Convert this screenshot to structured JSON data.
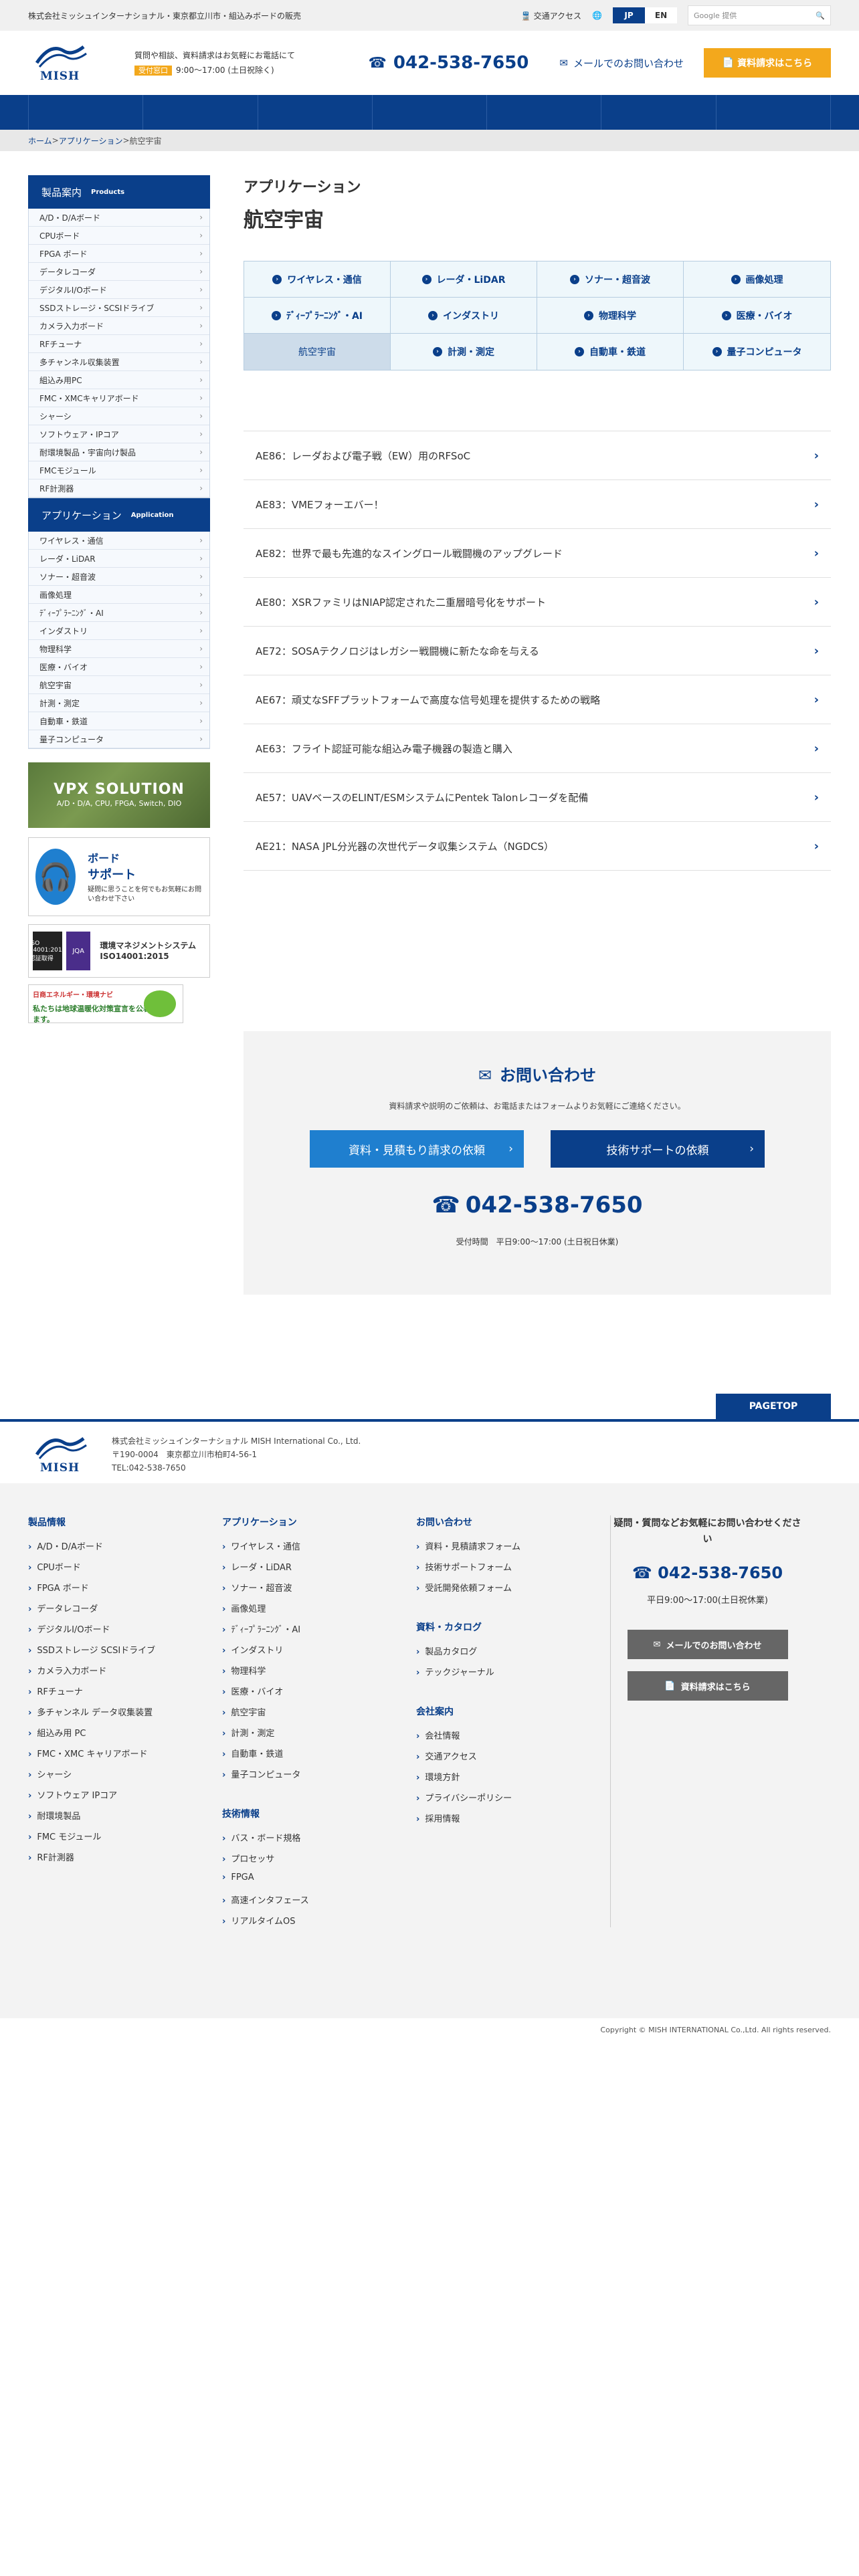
{
  "topbar": {
    "company": "株式会社ミッシュインターナショナル・東京都立川市・組込みボードの販売",
    "access": "交通アクセス",
    "lang_jp": "JP",
    "lang_en": "EN",
    "search_placeholder": "Google 提供",
    "colors": {
      "brand": "#0a3f8a",
      "accent": "#f3a81c"
    }
  },
  "header": {
    "logo": "MISH",
    "info": "質問や相談、資料請求はお気軽にお電話にて",
    "badge": "受付窓口",
    "hours": "9:00〜17:00 (土日祝除く)",
    "phone": "042-538-7650",
    "mail": "メールでのお問い合わせ",
    "request": "資料請求はこちら"
  },
  "breadcrumb": {
    "home": "ホーム",
    "sep1": " > ",
    "app": "アプリケーション",
    "sep2": " > ",
    "current": "航空宇宙"
  },
  "sidebar": {
    "products_title": "製品案内",
    "products_sub": "Products",
    "products": [
      "A/D・D/Aボード",
      "CPUボード",
      "FPGA ボード",
      "データレコーダ",
      "デジタルI/Oボード",
      "SSDストレージ・SCSIドライブ",
      "カメラ入力ボード",
      "RFチューナ",
      "多チャンネル収集装置",
      "組込み用PC",
      "FMC・XMCキャリアボード",
      "シャーシ",
      "ソフトウェア・IPコア",
      "耐環境製品・宇宙向け製品",
      "FMCモジュール",
      "RF計測器"
    ],
    "apps_title": "アプリケーション",
    "apps_sub": "Application",
    "apps": [
      "ワイヤレス・通信",
      "レーダ・LiDAR",
      "ソナー・超音波",
      "画像処理",
      "ﾃﾞｨｰﾌﾟﾗｰﾆﾝｸﾞ・AI",
      "インダストリ",
      "物理科学",
      "医療・バイオ",
      "航空宇宙",
      "計測・測定",
      "自動車・鉄道",
      "量子コンピュータ"
    ]
  },
  "banners": {
    "vpx_title": "VPX SOLUTION",
    "vpx_sub": "A/D・D/A, CPU, FPGA, Switch, DIO",
    "support_a": "ボード",
    "support_b": "サポート",
    "support_c": "疑問に思うことを何でもお気軽にお問い合わせ下さい",
    "iso_label": "環境マネジメントシステム ISO14001:2015",
    "iso_badge": "JQA",
    "iso_note": "ISO 14001:2015 認証取得",
    "eco_l1": "日商エネルギー・環境ナビ",
    "eco_l2": "私たちは地球温暖化対策宣言を公表しています。"
  },
  "content": {
    "caption": "アプリケーション",
    "title": "航空宇宙",
    "categories": [
      "ワイヤレス・通信",
      "レーダ・LiDAR",
      "ソナー・超音波",
      "画像処理",
      "ﾃﾞｨｰﾌﾟﾗｰﾆﾝｸﾞ・AI",
      "インダストリ",
      "物理科学",
      "医療・バイオ",
      "航空宇宙",
      "計測・測定",
      "自動車・鉄道",
      "量子コンピュータ"
    ],
    "articles": [
      "AE86：レーダおよび電子戦（EW）用のRFSoC",
      "AE83：VMEフォーエバー！",
      "AE82：世界で最も先進的なスイングロール戦闘機のアップグレード",
      "AE80：XSRファミリはNIAP認定された二重層暗号化をサポート",
      "AE72：SOSAテクノロジはレガシー戦闘機に新たな命を与える",
      "AE67：頑丈なSFFプラットフォームで高度な信号処理を提供するための戦略",
      "AE63：フライト認証可能な組込み電子機器の製造と購入",
      "AE57：UAVベースのELINT/ESMシステムにPentek Talonレコーダを配備",
      "AE21：NASA JPL分光器の次世代データ収集システム（NGDCS）"
    ]
  },
  "contact": {
    "title": "お問い合わせ",
    "desc": "資料請求や説明のご依頼は、お電話またはフォームよりお気軽にご連絡ください。",
    "btn1": "資料・見積もり請求の依頼",
    "btn2": "技術サポートの依頼",
    "phone": "042-538-7650",
    "hours": "受付時間　平日9:00〜17:00 (土日祝日休業)"
  },
  "pagetop": "PAGETOP",
  "footer": {
    "company": "株式会社ミッシュインターナショナル MISH International Co., Ltd.",
    "zip": "〒190-0004　東京都立川市柏町4-56-1",
    "tel": "TEL:042-538-7650",
    "col1_title": "製品情報",
    "col1": [
      "A/D・D/Aボード",
      "CPUボード",
      "FPGA ボード",
      "データレコーダ",
      "デジタルI/Oボード",
      "SSDストレージ SCSIドライブ",
      "カメラ入力ボード",
      "RFチューナ",
      "多チャンネル データ収集装置",
      "組込み用 PC",
      "FMC・XMC キャリアボード",
      "シャーシ",
      "ソフトウェア IPコア",
      "耐環境製品",
      "FMC モジュール",
      "RF計測器"
    ],
    "col2_title": "アプリケーション",
    "col2": [
      "ワイヤレス・通信",
      "レーダ・LiDAR",
      "ソナー・超音波",
      "画像処理",
      "ﾃﾞｨｰﾌﾟﾗｰﾆﾝｸﾞ・AI",
      "インダストリ",
      "物理科学",
      "医療・バイオ",
      "航空宇宙",
      "計測・測定",
      "自動車・鉄道",
      "量子コンピュータ"
    ],
    "col2b_title": "技術情報",
    "col2b": [
      "バス・ボード規格",
      "プロセッサ",
      "FPGA",
      "高速インタフェース",
      "リアルタイムOS"
    ],
    "col3_title": "お問い合わせ",
    "col3": [
      "資料・見積請求フォーム",
      "技術サポートフォーム",
      "受託開発依頼フォーム"
    ],
    "col3b_title": "資料・カタログ",
    "col3b": [
      "製品カタログ",
      "テックジャーナル"
    ],
    "col3c_title": "会社案内",
    "col3c": [
      "会社情報",
      "交通アクセス",
      "環境方針",
      "プライバシーポリシー",
      "採用情報"
    ],
    "q": "疑問・質問などお気軽にお問い合わせください",
    "phone": "042-538-7650",
    "hours": "平日9:00〜17:00(土日祝休業)",
    "mail": "メールでのお問い合わせ",
    "request": "資料請求はこちら",
    "copyright": "Copyright © MISH INTERNATIONAL Co.,Ltd. All rights reserved."
  }
}
